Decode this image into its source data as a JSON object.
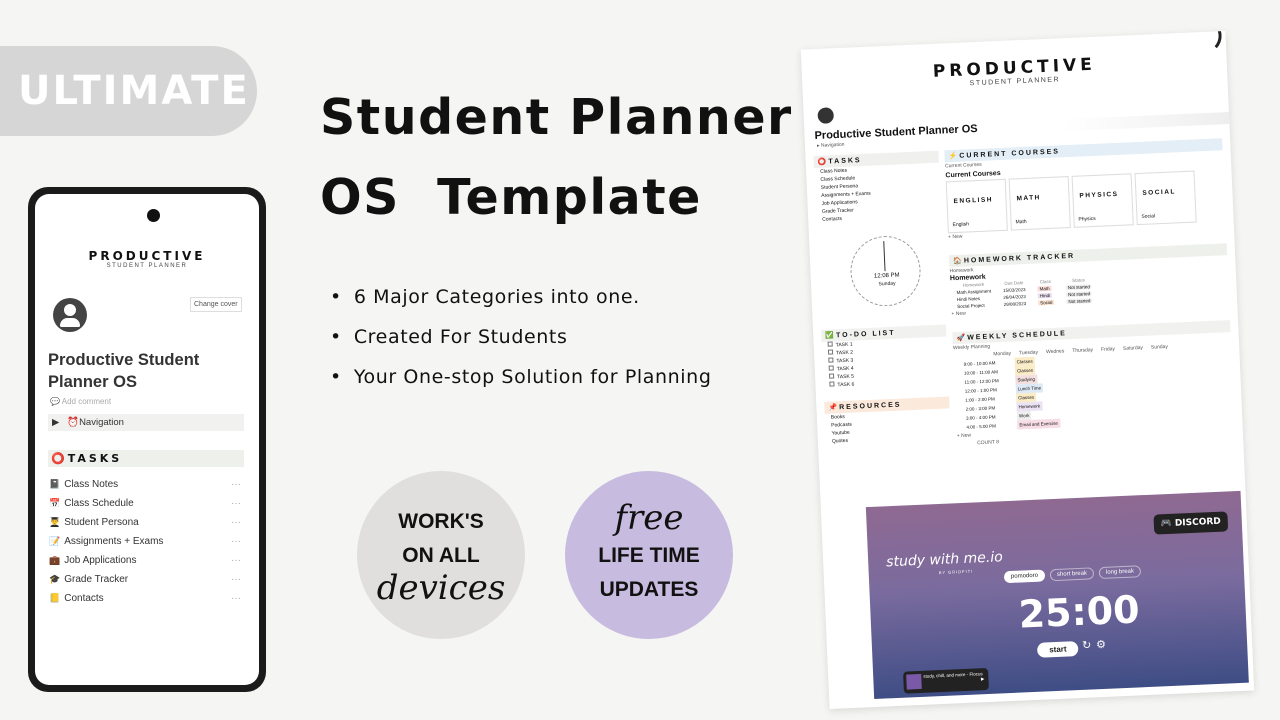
{
  "badge": "ULTIMATE",
  "headline": {
    "line1": "Student Planner",
    "line2": "OS  Template"
  },
  "bullets": [
    "6 Major Categories into one.",
    "Created For Students",
    "Your One-stop Solution for Planning"
  ],
  "circle_devices": {
    "line1": "WORK'S",
    "line2": "ON ALL",
    "script": "devices",
    "color": "#e0dfdd"
  },
  "circle_updates": {
    "script": "free",
    "line1": "LIFE TIME",
    "line2": "UPDATES",
    "color": "#c8bbe0"
  },
  "phone": {
    "brand": "PRODUCTIVE",
    "brand_sub": "STUDENT PLANNER",
    "change_cover": "Change cover",
    "page_title": "Productive Student Planner OS",
    "add_comment": "Add comment",
    "navigation": "Navigation",
    "tasks_heading": "TASKS",
    "tasks": [
      {
        "icon": "📓",
        "label": "Class Notes"
      },
      {
        "icon": "📅",
        "label": "Class Schedule"
      },
      {
        "icon": "👨‍🎓",
        "label": "Student Persona"
      },
      {
        "icon": "📝",
        "label": "Assignments + Exams"
      },
      {
        "icon": "💼",
        "label": "Job Applications"
      },
      {
        "icon": "🎓",
        "label": "Grade Tracker"
      },
      {
        "icon": "📒",
        "label": "Contacts"
      }
    ],
    "more": "···"
  },
  "sheet": {
    "brand": "PRODUCTIVE",
    "brand_sub": "STUDENT PLANNER",
    "page_title": "Productive Student Planner OS",
    "navigation": "Navigation",
    "tasks_heading": "TASKS",
    "tasks": [
      "Class Notes",
      "Class Schedule",
      "Student Persona",
      "Assignments + Exams",
      "Job Applications",
      "Grade Tracker",
      "Contacts"
    ],
    "clock": {
      "time": "12:08 PM",
      "day": "Sunday"
    },
    "courses": {
      "heading": "CURRENT COURSES",
      "view": "Current Courses",
      "title": "Current Courses",
      "cards": [
        {
          "banner": "ENGLISH",
          "name": "English"
        },
        {
          "banner": "MATH",
          "name": "Math"
        },
        {
          "banner": "PHYSICS",
          "name": "Physics"
        },
        {
          "banner": "SOCIAL",
          "name": "Social"
        }
      ],
      "new": "+ New"
    },
    "homework": {
      "heading": "HOMEWORK TRACKER",
      "view": "Homework",
      "title": "Homework",
      "columns": [
        "Homework",
        "Due Date",
        "Class",
        "Status"
      ],
      "rows": [
        {
          "name": "Math Assignment",
          "date": "15/03/2023",
          "class": "Math",
          "status": "Not started"
        },
        {
          "name": "Hindi Notes",
          "date": "26/04/2023",
          "class": "Hindi",
          "status": "Not started"
        },
        {
          "name": "Social Project",
          "date": "29/08/2023",
          "class": "Social",
          "status": "Not started"
        }
      ],
      "new": "+ New"
    },
    "todo": {
      "heading": "TO-DO LIST",
      "items": [
        "TASK 1",
        "TASK 2",
        "TASK 3",
        "TASK 4",
        "TASK 5",
        "TASK 6"
      ]
    },
    "resources": {
      "heading": "RESOURCES",
      "items": [
        "Books",
        "Podcasts",
        "Youtube",
        "Quotes"
      ]
    },
    "weekly": {
      "heading": "WEEKLY SCHEDULE",
      "view": "Weekly Planning",
      "days": [
        "Monday",
        "Tuesday",
        "Wednes",
        "Thursday",
        "Friday",
        "Saturday",
        "Sunday"
      ],
      "slots": [
        {
          "time": "9:00 - 10:00 AM",
          "task": "Classes"
        },
        {
          "time": "10:00 - 11:00 AM",
          "task": "Classes"
        },
        {
          "time": "11:00 - 12:00 PM",
          "task": "Studying"
        },
        {
          "time": "12:00 - 1:00 PM",
          "task": "Lunch Time"
        },
        {
          "time": "1:00 - 2:00 PM",
          "task": "Classes"
        },
        {
          "time": "2:00 - 3:00 PM",
          "task": "Homework"
        },
        {
          "time": "3:00 - 4:00 PM",
          "task": "Work"
        },
        {
          "time": "4:00 - 5:00 PM",
          "task": "Email and Exercise"
        }
      ],
      "new": "+ New",
      "count": "COUNT 8"
    },
    "pomodoro": {
      "logo": "study with me.io",
      "logo_sub": "BY GRIDFITI",
      "tabs": [
        "pomodoro",
        "short break",
        "long break"
      ],
      "timer": "25:00",
      "start": "start",
      "discord": "DISCORD",
      "music": "study, chill, and more - Flocus"
    }
  }
}
